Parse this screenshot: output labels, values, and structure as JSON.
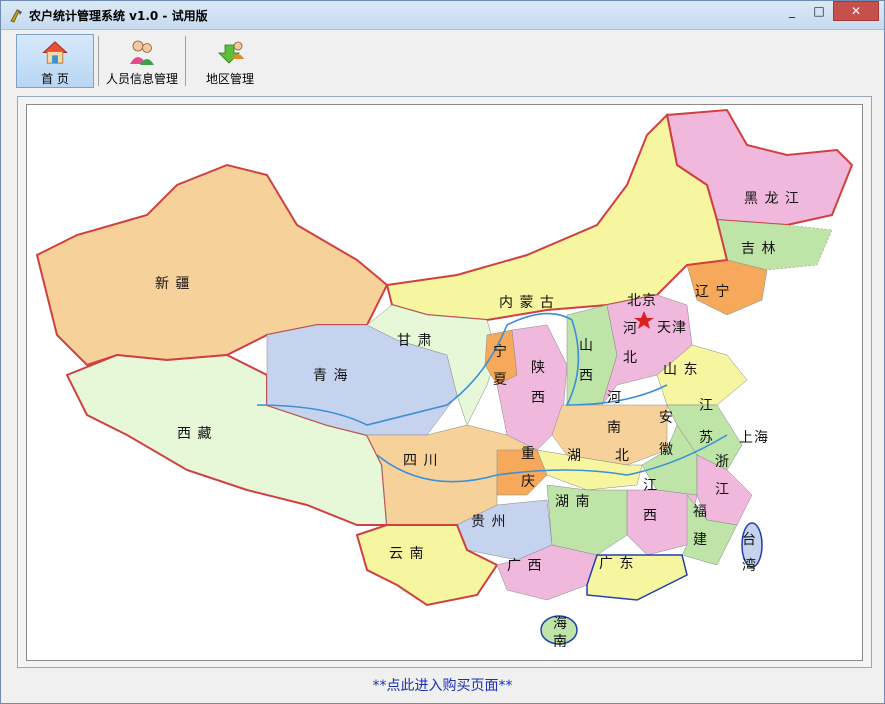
{
  "window": {
    "title": "农户统计管理系统 v1.0 - 试用版",
    "min_glyph": "_",
    "max_glyph": "□",
    "close_glyph": "✕"
  },
  "toolbar": {
    "items": [
      {
        "label": "首  页",
        "icon": "home-icon"
      },
      {
        "label": "人员信息管理",
        "icon": "people-icon"
      },
      {
        "label": "地区管理",
        "icon": "region-icon"
      }
    ]
  },
  "map": {
    "labels": [
      {
        "text": "黑 龙 江"
      },
      {
        "text": "吉  林"
      },
      {
        "text": "辽  宁"
      },
      {
        "text": "北京"
      },
      {
        "text": "天津"
      },
      {
        "text": "河"
      },
      {
        "text": "北"
      },
      {
        "text": "内 蒙 古"
      },
      {
        "text": "新  疆"
      },
      {
        "text": "甘  肃"
      },
      {
        "text": "宁"
      },
      {
        "text": "夏"
      },
      {
        "text": "青  海"
      },
      {
        "text": "西  藏"
      },
      {
        "text": "陕"
      },
      {
        "text": "西"
      },
      {
        "text": "山"
      },
      {
        "text": "西"
      },
      {
        "text": "山  东"
      },
      {
        "text": "河"
      },
      {
        "text": "南"
      },
      {
        "text": "江"
      },
      {
        "text": "苏"
      },
      {
        "text": "安"
      },
      {
        "text": "徽"
      },
      {
        "text": "上海"
      },
      {
        "text": "四  川"
      },
      {
        "text": "重"
      },
      {
        "text": "庆"
      },
      {
        "text": "湖"
      },
      {
        "text": "北"
      },
      {
        "text": "浙"
      },
      {
        "text": "江"
      },
      {
        "text": "江"
      },
      {
        "text": "西"
      },
      {
        "text": "湖  南"
      },
      {
        "text": "贵  州"
      },
      {
        "text": "福"
      },
      {
        "text": "建"
      },
      {
        "text": "台"
      },
      {
        "text": "湾"
      },
      {
        "text": "云  南"
      },
      {
        "text": "广  西"
      },
      {
        "text": "广  东"
      },
      {
        "text": "海"
      },
      {
        "text": "南"
      }
    ]
  },
  "footer": {
    "buy_link": "**点此进入购买页面**"
  }
}
